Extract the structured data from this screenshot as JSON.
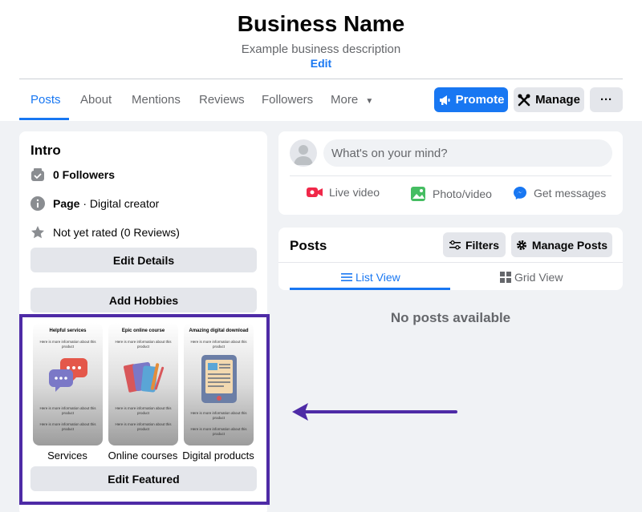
{
  "header": {
    "business_name": "Business Name",
    "description": "Example business description",
    "edit_label": "Edit"
  },
  "tabs": [
    {
      "label": "Posts",
      "active": true
    },
    {
      "label": "About",
      "active": false
    },
    {
      "label": "Mentions",
      "active": false
    },
    {
      "label": "Reviews",
      "active": false
    },
    {
      "label": "Followers",
      "active": false
    },
    {
      "label": "More",
      "active": false
    }
  ],
  "actions": {
    "promote_label": "Promote",
    "manage_label": "Manage",
    "more_label": "···"
  },
  "intro": {
    "title": "Intro",
    "followers": "0 Followers",
    "page_type_bold": "Page",
    "page_type_rest": " · Digital creator",
    "rating": "Not yet rated (0 Reviews)",
    "edit_details_label": "Edit Details",
    "add_hobbies_label": "Add Hobbies"
  },
  "featured": {
    "items": [
      {
        "title": "Helpful services",
        "desc": "Here is more information about this product",
        "label": "Services"
      },
      {
        "title": "Epic online course",
        "desc": "Here is more information about this product",
        "label": "Online courses"
      },
      {
        "title": "Amazing digital download",
        "desc": "Here is more information about this product",
        "label": "Digital products"
      }
    ],
    "edit_featured_label": "Edit Featured"
  },
  "composer": {
    "placeholder": "What's on your mind?",
    "live_video_label": "Live video",
    "photo_video_label": "Photo/video",
    "get_messages_label": "Get messages"
  },
  "posts": {
    "title": "Posts",
    "filters_label": "Filters",
    "manage_posts_label": "Manage Posts",
    "list_view_label": "List View",
    "grid_view_label": "Grid View",
    "empty_label": "No posts available"
  },
  "colors": {
    "accent": "#1877f2",
    "highlight_box": "#4e2ba6",
    "arrow": "#4e2ba6"
  }
}
